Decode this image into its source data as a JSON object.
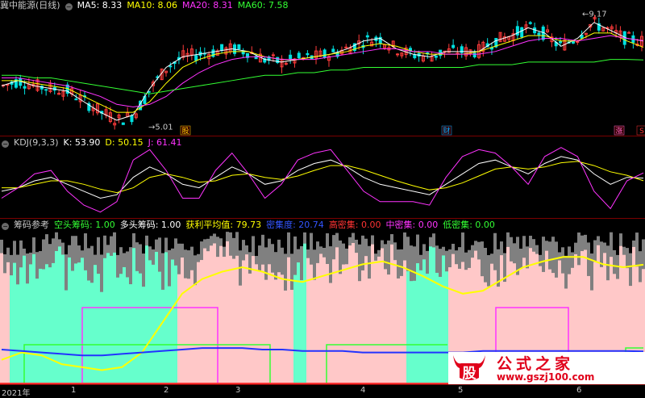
{
  "panel1": {
    "title": "冀中能源(日线)",
    "chip": "−",
    "indicators": [
      {
        "label": "MA5: 8.33",
        "color": "#ffffff"
      },
      {
        "label": "MA10: 8.06",
        "color": "#ffff00"
      },
      {
        "label": "MA20: 8.31",
        "color": "#ff33ff"
      },
      {
        "label": "MA60: 7.58",
        "color": "#33ff33"
      }
    ],
    "high_label": "←9.17",
    "low_label": "→5.01",
    "markers": [
      "股",
      "财",
      "涨",
      "S"
    ]
  },
  "panel2": {
    "chip": "−",
    "indicators": [
      {
        "label": "KDJ(9,3,3)",
        "color": "#c8c8c8"
      },
      {
        "label": "K: 53.90",
        "color": "#ffffff"
      },
      {
        "label": "D: 50.15",
        "color": "#ffff00"
      },
      {
        "label": "J: 61.41",
        "color": "#ff33ff"
      }
    ]
  },
  "panel3": {
    "chip": "−",
    "indicators": [
      {
        "label": "筹码参考",
        "color": "#c8c8c8"
      },
      {
        "label": "空头筹码: 1.00",
        "color": "#33ff33"
      },
      {
        "label": "多头筹码: 1.00",
        "color": "#ffffff"
      },
      {
        "label": "获利平均值: 79.73",
        "color": "#ffff00"
      },
      {
        "label": "密集度: 20.74",
        "color": "#3355ff"
      },
      {
        "label": "高密集: 0.00",
        "color": "#ff3333"
      },
      {
        "label": "中密集: 0.00",
        "color": "#ff33ff"
      },
      {
        "label": "低密集: 0.00",
        "color": "#33ff33"
      }
    ]
  },
  "date_axis": [
    "2021年",
    "1",
    "2",
    "3",
    "4",
    "5",
    "6"
  ],
  "logo": {
    "glyph": "股",
    "name": "公式之家",
    "url": "www.gszj100.com"
  },
  "colors": {
    "up": "#ff3b3b",
    "down": "#00e0e0",
    "ma5": "#ffffff",
    "ma10": "#ffff00",
    "ma20": "#ff33ff",
    "ma60": "#33ff33",
    "pink": "#ffc8c8",
    "teal": "#66ffcc",
    "gray": "#808080"
  },
  "chart_data": [
    {
      "type": "candlestick",
      "title": "冀中能源(日线)",
      "series": [
        {
          "name": "MA5",
          "close_path": [
            6.6,
            6.8,
            6.6,
            6.5,
            6.4,
            6.0,
            5.6,
            5.3,
            5.5,
            6.5,
            7.3,
            7.7,
            7.8,
            7.9,
            8.0,
            7.9,
            7.6,
            7.5,
            7.6,
            7.7,
            7.8,
            8.0,
            8.3,
            8.4,
            8.0,
            7.8,
            7.7,
            7.9,
            7.9,
            7.9,
            8.3,
            8.5,
            8.8,
            8.6,
            8.1,
            8.4,
            9.0,
            8.7,
            8.4,
            8.3
          ]
        },
        {
          "name": "MA10",
          "close_path": [
            6.8,
            6.8,
            6.7,
            6.6,
            6.5,
            6.2,
            5.9,
            5.6,
            5.6,
            6.0,
            6.7,
            7.3,
            7.6,
            7.8,
            7.9,
            7.9,
            7.7,
            7.6,
            7.6,
            7.7,
            7.8,
            7.9,
            8.1,
            8.2,
            8.1,
            7.9,
            7.8,
            7.8,
            7.8,
            7.9,
            8.1,
            8.3,
            8.5,
            8.5,
            8.3,
            8.3,
            8.6,
            8.6,
            8.3,
            8.06
          ]
        },
        {
          "name": "MA20",
          "close_path": [
            6.9,
            6.9,
            6.8,
            6.7,
            6.6,
            6.4,
            6.2,
            5.9,
            5.8,
            5.9,
            6.2,
            6.7,
            7.1,
            7.4,
            7.6,
            7.7,
            7.7,
            7.6,
            7.6,
            7.6,
            7.7,
            7.8,
            7.9,
            8.0,
            8.0,
            7.9,
            7.9,
            7.8,
            7.8,
            7.8,
            7.9,
            8.1,
            8.3,
            8.4,
            8.4,
            8.3,
            8.4,
            8.5,
            8.4,
            8.31
          ]
        },
        {
          "name": "MA60",
          "close_path": [
            7.0,
            7.0,
            6.9,
            6.9,
            6.8,
            6.7,
            6.6,
            6.5,
            6.4,
            6.3,
            6.4,
            6.5,
            6.6,
            6.7,
            6.8,
            6.9,
            7.0,
            7.0,
            7.1,
            7.1,
            7.2,
            7.2,
            7.3,
            7.3,
            7.3,
            7.3,
            7.3,
            7.3,
            7.3,
            7.4,
            7.4,
            7.4,
            7.5,
            7.5,
            7.5,
            7.5,
            7.5,
            7.6,
            7.6,
            7.58
          ]
        }
      ],
      "ylim": [
        4.9,
        9.3
      ],
      "annotations": [
        "←9.17",
        "→5.01"
      ]
    },
    {
      "type": "line",
      "title": "KDJ(9,3,3)",
      "series": [
        {
          "name": "K",
          "values": [
            35,
            40,
            50,
            55,
            45,
            35,
            25,
            30,
            55,
            70,
            60,
            45,
            40,
            55,
            70,
            60,
            45,
            50,
            65,
            75,
            80,
            70,
            55,
            45,
            40,
            35,
            30,
            45,
            60,
            75,
            80,
            70,
            60,
            75,
            85,
            80,
            60,
            45,
            55,
            53.9
          ]
        },
        {
          "name": "D",
          "values": [
            40,
            40,
            45,
            50,
            50,
            45,
            38,
            33,
            40,
            55,
            60,
            55,
            48,
            50,
            58,
            60,
            55,
            52,
            57,
            65,
            72,
            72,
            66,
            58,
            50,
            43,
            37,
            40,
            47,
            57,
            67,
            70,
            67,
            70,
            76,
            78,
            72,
            63,
            58,
            50.15
          ]
        },
        {
          "name": "J",
          "values": [
            25,
            40,
            60,
            65,
            35,
            15,
            5,
            20,
            80,
            95,
            65,
            25,
            25,
            65,
            90,
            60,
            25,
            45,
            80,
            90,
            95,
            65,
            35,
            20,
            20,
            20,
            15,
            55,
            85,
            95,
            90,
            70,
            45,
            85,
            98,
            85,
            35,
            10,
            50,
            61.41
          ]
        }
      ],
      "ylim": [
        0,
        100
      ]
    },
    {
      "type": "area",
      "title": "筹码参考",
      "series": [
        {
          "name": "获利平均值",
          "values": [
            15,
            20,
            18,
            12,
            10,
            8,
            10,
            20,
            40,
            60,
            70,
            75,
            78,
            75,
            70,
            68,
            72,
            76,
            80,
            82,
            78,
            72,
            65,
            60,
            62,
            70,
            78,
            82,
            85,
            85,
            80,
            78,
            79.73
          ]
        },
        {
          "name": "密集度",
          "values": [
            22,
            21,
            20,
            19,
            18,
            18,
            19,
            20,
            21,
            22,
            23,
            23,
            23,
            22,
            22,
            21,
            21,
            21,
            20,
            20,
            20,
            20,
            20,
            20,
            21,
            21,
            21,
            21,
            21,
            21,
            21,
            21,
            20.74
          ]
        }
      ],
      "ylim": [
        0,
        100
      ]
    }
  ]
}
